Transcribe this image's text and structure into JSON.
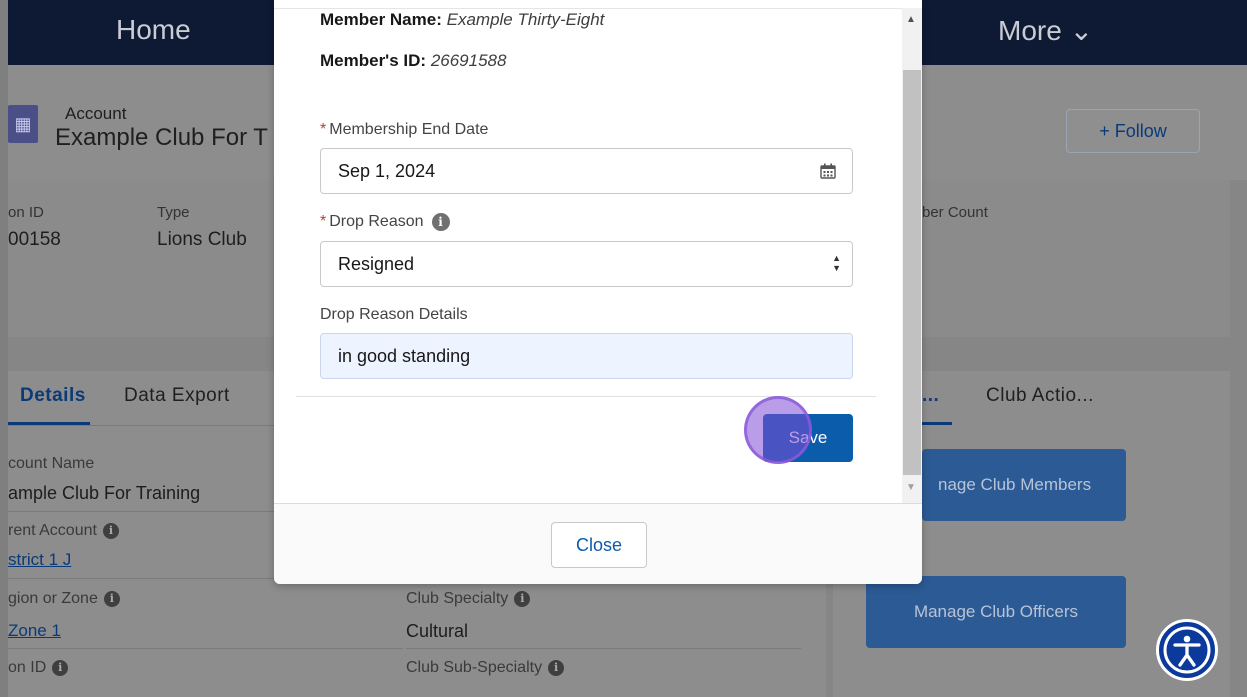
{
  "nav": {
    "home": "Home",
    "more": "More ⌄"
  },
  "account": {
    "label": "Account",
    "name": "Example Club For T",
    "follow": "+ Follow"
  },
  "highlights": [
    {
      "label": "on ID",
      "value": "00158"
    },
    {
      "label": "Type",
      "value": "Lions Club"
    },
    {
      "label": "ber Count",
      "value": ""
    }
  ],
  "tabs": {
    "details": "Details",
    "export": "Data Export",
    "dots": "...",
    "actions": "Club Actio..."
  },
  "fields": {
    "account_name_label": "count Name",
    "account_name_value": "ample Club For Training",
    "parent_label": "rent Account",
    "parent_value": "strict 1 J",
    "region_label": "gion or Zone",
    "region_value": "Zone 1",
    "lion_id_label": "on ID",
    "specialty_label": "Club Specialty",
    "specialty_value": "Cultural",
    "subspecialty_label": "Club Sub-Specialty"
  },
  "actions": {
    "members": "Manage Club Members",
    "members_visible": "nage Club Members",
    "officers": "Manage Club Officers"
  },
  "modal": {
    "member_name_label": "Member Name:",
    "member_name_value": "Example Thirty-Eight",
    "member_id_label": "Member's ID:",
    "member_id_value": "26691588",
    "end_date_label": "Membership End Date",
    "end_date_value": "Sep 1, 2024",
    "drop_reason_label": "Drop Reason",
    "drop_reason_value": "Resigned",
    "drop_details_label": "Drop Reason Details",
    "drop_details_value": "in good standing",
    "save": "Save",
    "close": "Close"
  },
  "colors": {
    "nav": "#0e1a33",
    "brand": "#0b5cab",
    "highlight_ring": "#804cd6"
  }
}
